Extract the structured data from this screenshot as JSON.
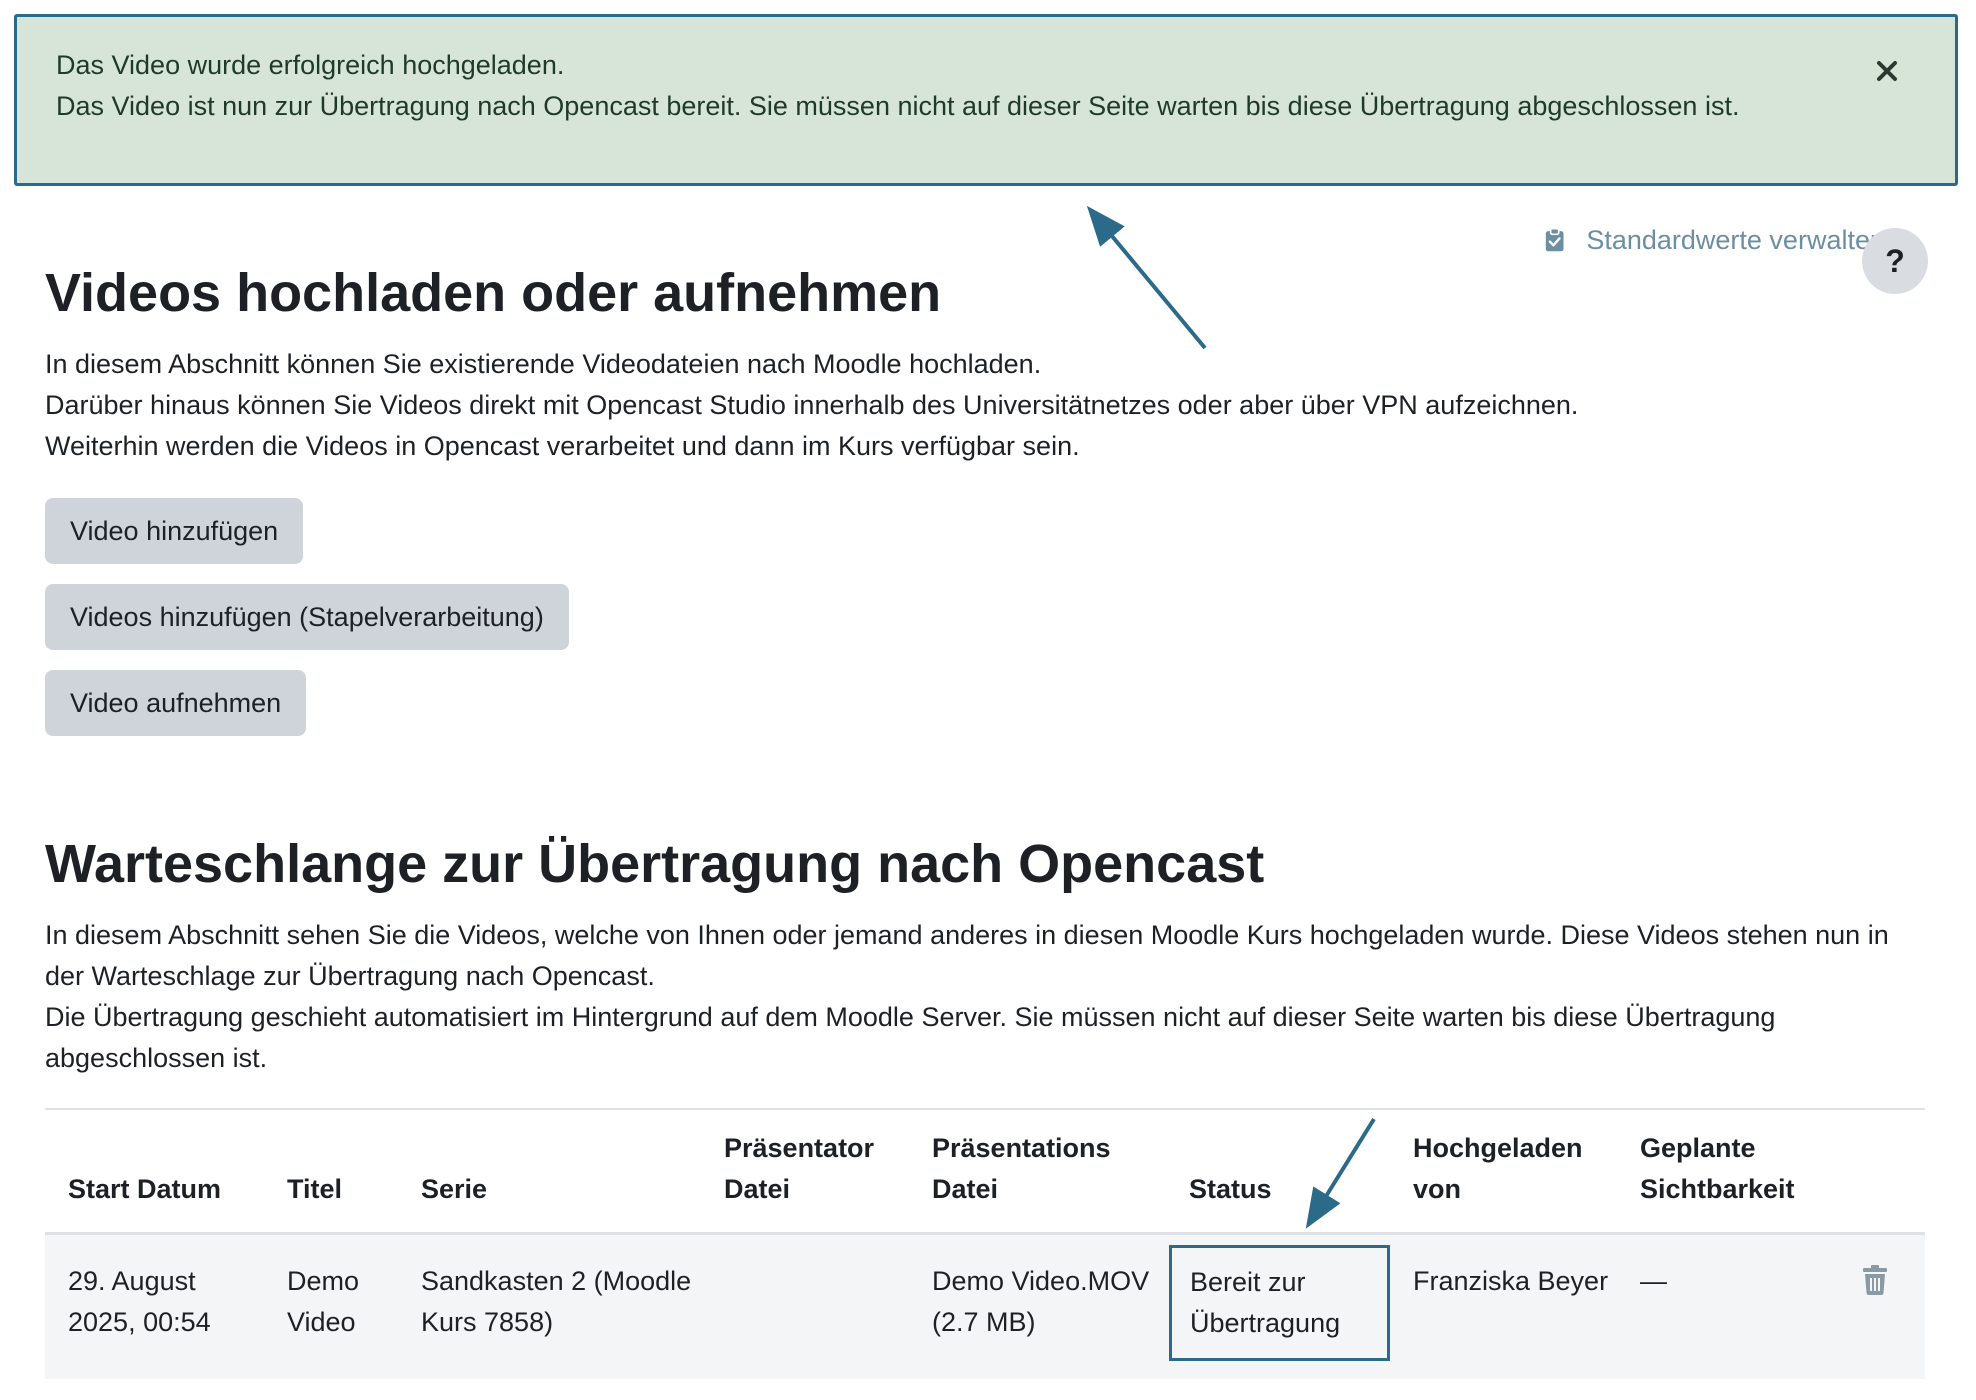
{
  "alert": {
    "line1": "Das Video wurde erfolgreich hochgeladen.",
    "line2": "Das Video ist nun zur Übertragung nach Opencast bereit. Sie müssen nicht auf dieser Seite warten bis diese Übertragung abgeschlossen ist."
  },
  "top_actions": {
    "defaults_label": "Standardwerte verwalten",
    "help_label": "?"
  },
  "upload_section": {
    "title": "Videos hochladen oder aufnehmen",
    "desc1": "In diesem Abschnitt können Sie existierende Videodateien nach Moodle hochladen.",
    "desc2": "Darüber hinaus können Sie Videos direkt mit Opencast Studio innerhalb des Universitätnetzes oder aber über VPN aufzeichnen.",
    "desc3": "Weiterhin werden die Videos in Opencast verarbeitet und dann im Kurs verfügbar sein.",
    "buttons": {
      "add_video": "Video hinzufügen",
      "add_batch": "Videos hinzufügen (Stapelverarbeitung)",
      "record": "Video aufnehmen"
    }
  },
  "queue_section": {
    "title": "Warteschlange zur Übertragung nach Opencast",
    "desc1": "In diesem Abschnitt sehen Sie die Videos, welche von Ihnen oder jemand anderes in diesen Moodle Kurs hochgeladen wurde. Diese Videos stehen nun in der Warteschlage zur Übertragung nach Opencast.",
    "desc2": "Die Übertragung geschieht automatisiert im Hintergrund auf dem Moodle Server. Sie müssen nicht auf dieser Seite warten bis diese Übertragung abgeschlossen ist."
  },
  "table": {
    "headers": {
      "start_date": "Start Datum",
      "title": "Titel",
      "series": "Serie",
      "presenter_file": "Präsentator Datei",
      "presentation_file": "Präsentations Datei",
      "status": "Status",
      "uploaded_by": "Hochgeladen von",
      "visibility": "Geplante Sichtbarkeit"
    },
    "rows": [
      {
        "start_date": "29. August 2025, 00:54",
        "title": "Demo Video",
        "series": "Sandkasten 2 (Moodle Kurs 7858)",
        "presenter_file": "",
        "presentation_file": "Demo Video.MOV (2.7 MB)",
        "status": "Bereit zur Übertragung",
        "uploaded_by": "Franziska Beyer",
        "visibility": "—"
      }
    ]
  },
  "icons": {
    "close": "close-icon",
    "clipboard": "clipboard-check-icon",
    "trash": "trash-icon",
    "arrow": "annotation-arrow"
  },
  "colors": {
    "alert_bg": "#d7e5d9",
    "annotation": "#2c6a8a",
    "button_bg": "#ced4da",
    "link": "#6c8ea2"
  }
}
